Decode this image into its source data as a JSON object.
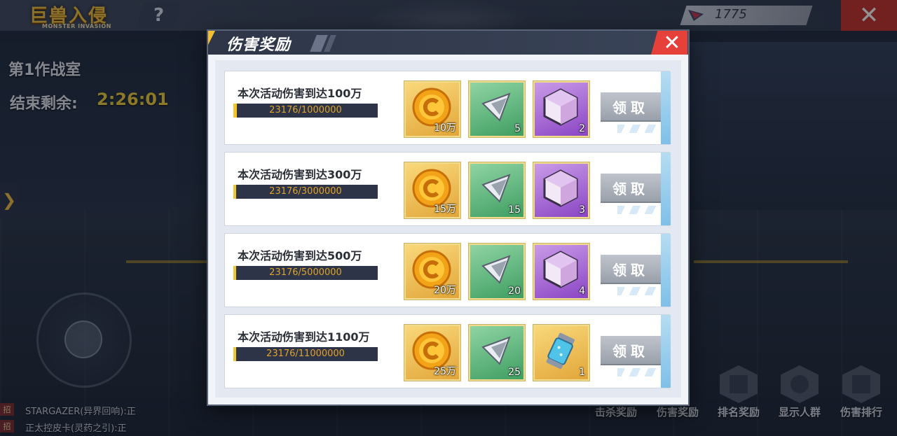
{
  "header": {
    "logo_text": "巨兽入侵",
    "logo_subtext": "MONSTER INVASION",
    "help_label": "?",
    "currency_value": "1775",
    "close_label": "✕"
  },
  "hud": {
    "room_name": "第1作战室",
    "timer_label": "结束剩余:",
    "timer_value": "2:26:01",
    "side_arrow": "❯"
  },
  "chat": [
    {
      "tag": "招",
      "text": "STARGAZER(异界回响):正"
    },
    {
      "tag": "招",
      "text": "正太控皮卡(灵药之引):正"
    }
  ],
  "bottom_nav": [
    {
      "label": "击杀奖励",
      "icon": "trophy-icon"
    },
    {
      "label": "伤害奖励",
      "icon": "damage-icon"
    },
    {
      "label": "排名奖励",
      "icon": "bar-chart-icon"
    },
    {
      "label": "显示人群",
      "icon": "user-icon"
    },
    {
      "label": "伤害排行",
      "icon": "ranking-icon"
    }
  ],
  "modal": {
    "title": "伤害奖励",
    "close_label": "✕",
    "rows": [
      {
        "title": "本次活动伤害到达100万",
        "progress_text": "23176/1000000",
        "progress": 0.023,
        "rewards": [
          {
            "type": "coin",
            "count": "10万"
          },
          {
            "type": "shard",
            "count": "5"
          },
          {
            "type": "cube",
            "count": "2"
          }
        ],
        "claim_label": "领取"
      },
      {
        "title": "本次活动伤害到达300万",
        "progress_text": "23176/3000000",
        "progress": 0.0077,
        "rewards": [
          {
            "type": "coin",
            "count": "15万"
          },
          {
            "type": "shard",
            "count": "15"
          },
          {
            "type": "cube",
            "count": "3"
          }
        ],
        "claim_label": "领取"
      },
      {
        "title": "本次活动伤害到达500万",
        "progress_text": "23176/5000000",
        "progress": 0.0046,
        "rewards": [
          {
            "type": "coin",
            "count": "20万"
          },
          {
            "type": "shard",
            "count": "20"
          },
          {
            "type": "cube",
            "count": "4"
          }
        ],
        "claim_label": "领取"
      },
      {
        "title": "本次活动伤害到达1100万",
        "progress_text": "23176/11000000",
        "progress": 0.0021,
        "rewards": [
          {
            "type": "coin",
            "count": "25万"
          },
          {
            "type": "shard",
            "count": "25"
          },
          {
            "type": "capsule",
            "count": "1"
          }
        ],
        "claim_label": "领取"
      }
    ]
  },
  "colors": {
    "accent_yellow": "#f4c52a",
    "close_red": "#e6403a",
    "claim_gray": "#a9afb8"
  }
}
